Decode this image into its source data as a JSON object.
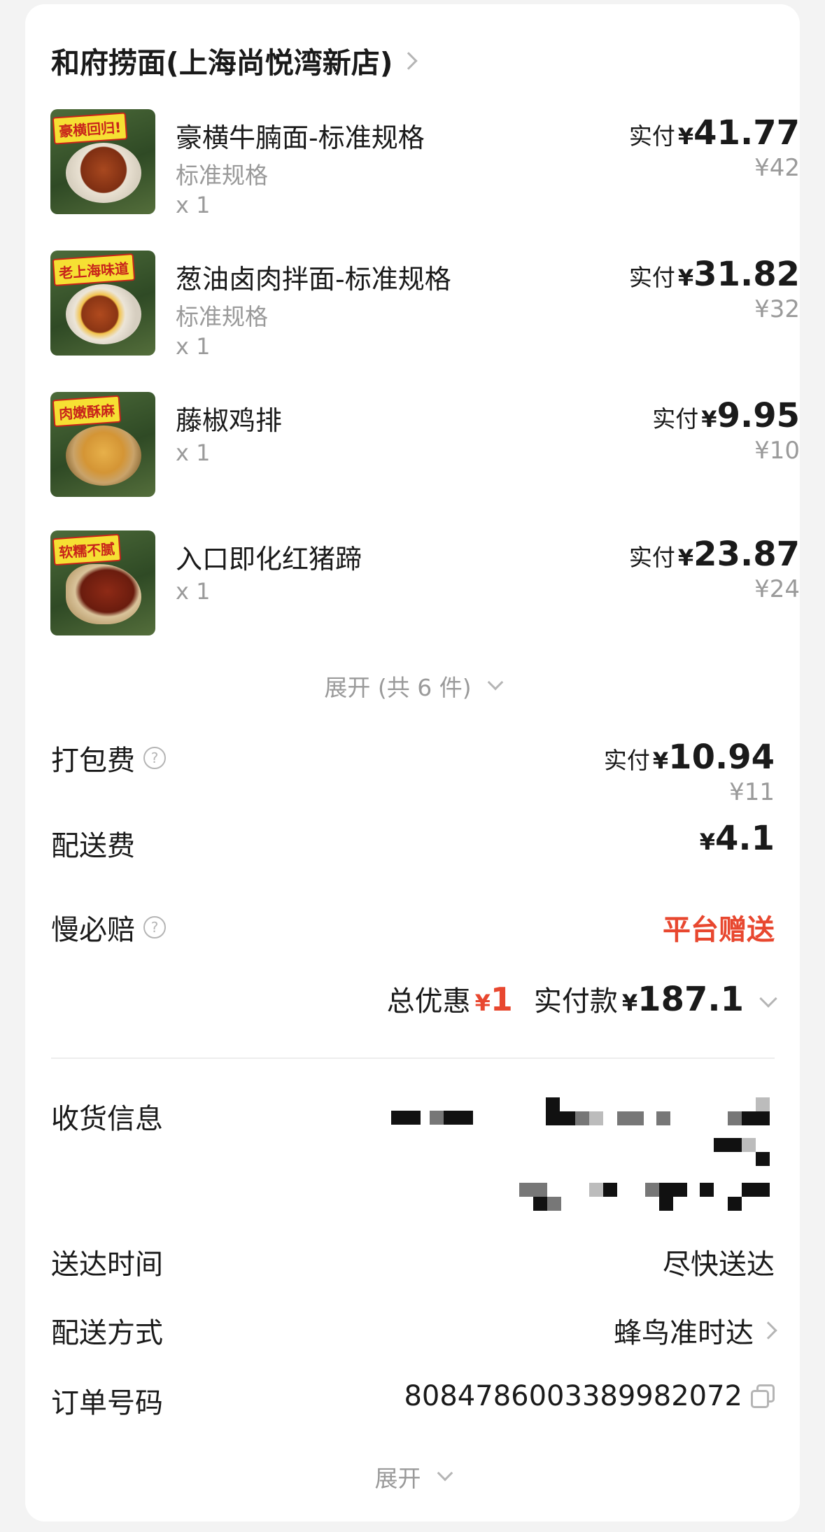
{
  "store": {
    "name": "和府捞面(上海尚悦湾新店)"
  },
  "items": [
    {
      "name": "豪横牛腩面-标准规格",
      "spec": "标准规格",
      "qty": "x 1",
      "paid_label": "实付",
      "currency": "¥",
      "paid": "41.77",
      "original": "¥42",
      "image_tag": "豪横回归!",
      "image_icon": "beef-noodle-photo-icon"
    },
    {
      "name": "葱油卤肉拌面-标准规格",
      "spec": "标准规格",
      "qty": "x 1",
      "paid_label": "实付",
      "currency": "¥",
      "paid": "31.82",
      "original": "¥32",
      "image_tag": "老上海味道",
      "image_icon": "braised-pork-noodle-photo-icon"
    },
    {
      "name": "藤椒鸡排",
      "spec": "",
      "qty": "x 1",
      "paid_label": "实付",
      "currency": "¥",
      "paid": "9.95",
      "original": "¥10",
      "image_tag": "肉嫩酥麻",
      "image_icon": "chicken-cutlet-photo-icon"
    },
    {
      "name": "入口即化红猪蹄",
      "spec": "",
      "qty": "x 1",
      "paid_label": "实付",
      "currency": "¥",
      "paid": "23.87",
      "original": "¥24",
      "image_tag": "软糯不腻",
      "image_icon": "pig-trotter-photo-icon"
    }
  ],
  "expand_items": {
    "label": "展开 (共 6 件)"
  },
  "fees": {
    "packaging": {
      "label": "打包费",
      "paid_label": "实付",
      "currency": "¥",
      "paid": "10.94",
      "original": "¥11"
    },
    "delivery": {
      "label": "配送费",
      "currency": "¥",
      "value": "4.1"
    },
    "late_guarantee": {
      "label": "慢必赔",
      "value": "平台赠送"
    }
  },
  "totals": {
    "discount_label": "总优惠",
    "currency": "¥",
    "discount": "1",
    "paid_label": "实付款",
    "paid": "187.1"
  },
  "info": {
    "address_label": "收货信息",
    "delivery_time_label": "送达时间",
    "delivery_time_value": "尽快送达",
    "delivery_method_label": "配送方式",
    "delivery_method_value": "蜂鸟准时达",
    "order_no_label": "订单号码",
    "order_no_value": "8084786003389982072"
  },
  "expand_bottom": {
    "label": "展开"
  },
  "colors": {
    "accent_red": "#e8472f",
    "muted": "#9a9a9a",
    "page_bg": "#f3f3f3"
  }
}
